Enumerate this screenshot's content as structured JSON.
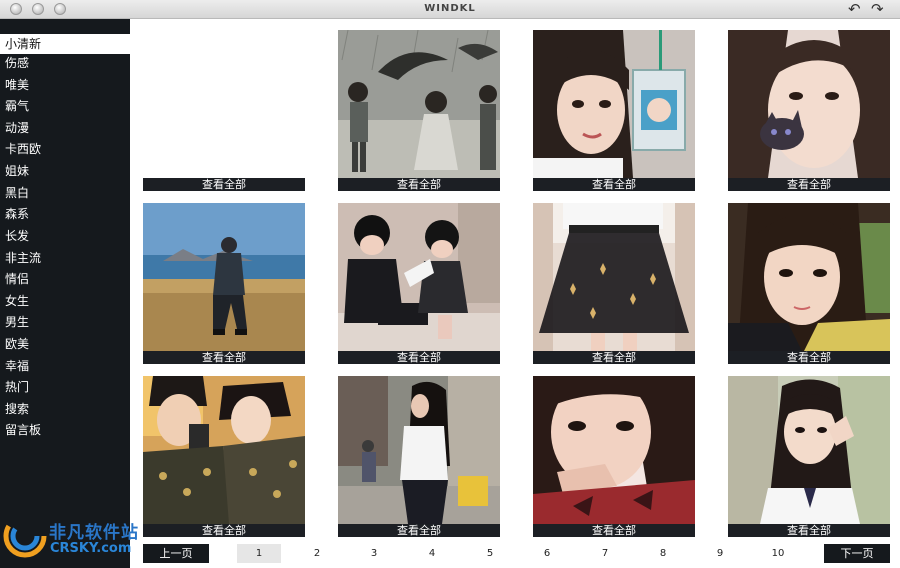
{
  "window": {
    "title": "WINDKL"
  },
  "sidebar": {
    "categories": [
      "小清新",
      "伤感",
      "唯美",
      "霸气",
      "动漫",
      "卡西欧",
      "姐妹",
      "黑白",
      "森系",
      "长发",
      "非主流",
      "情侣",
      "女生",
      "男生",
      "欧美",
      "幸福",
      "热门",
      "搜索",
      "留言板"
    ],
    "active_index": 0
  },
  "grid": {
    "view_all_label": "查看全部",
    "tiles": [
      {
        "empty": true
      },
      {
        "image": "rain-umbrella-children-photo"
      },
      {
        "image": "girl-with-drink-photo"
      },
      {
        "image": "girl-with-cat-photo"
      },
      {
        "image": "seaside-sitting-photo"
      },
      {
        "image": "two-kids-photo"
      },
      {
        "image": "tulle-skirt-photo"
      },
      {
        "image": "girl-portrait-photo"
      },
      {
        "image": "couple-selfie-photo"
      },
      {
        "image": "street-girl-photo"
      },
      {
        "image": "girl-closeup-photo"
      },
      {
        "image": "schoolgirl-photo"
      }
    ]
  },
  "pagination": {
    "prev_label": "上一页",
    "next_label": "下一页",
    "pages": [
      "1",
      "2",
      "3",
      "4",
      "5",
      "6",
      "7",
      "8",
      "9",
      "10"
    ],
    "current_page": "1"
  },
  "watermark": {
    "cn": "非凡软件站",
    "en": "CRSKY.com"
  },
  "colors": {
    "sidebar_bg": "#15191d",
    "caption_bg": "#1c1f24",
    "active_item_bg": "#ffffff"
  }
}
